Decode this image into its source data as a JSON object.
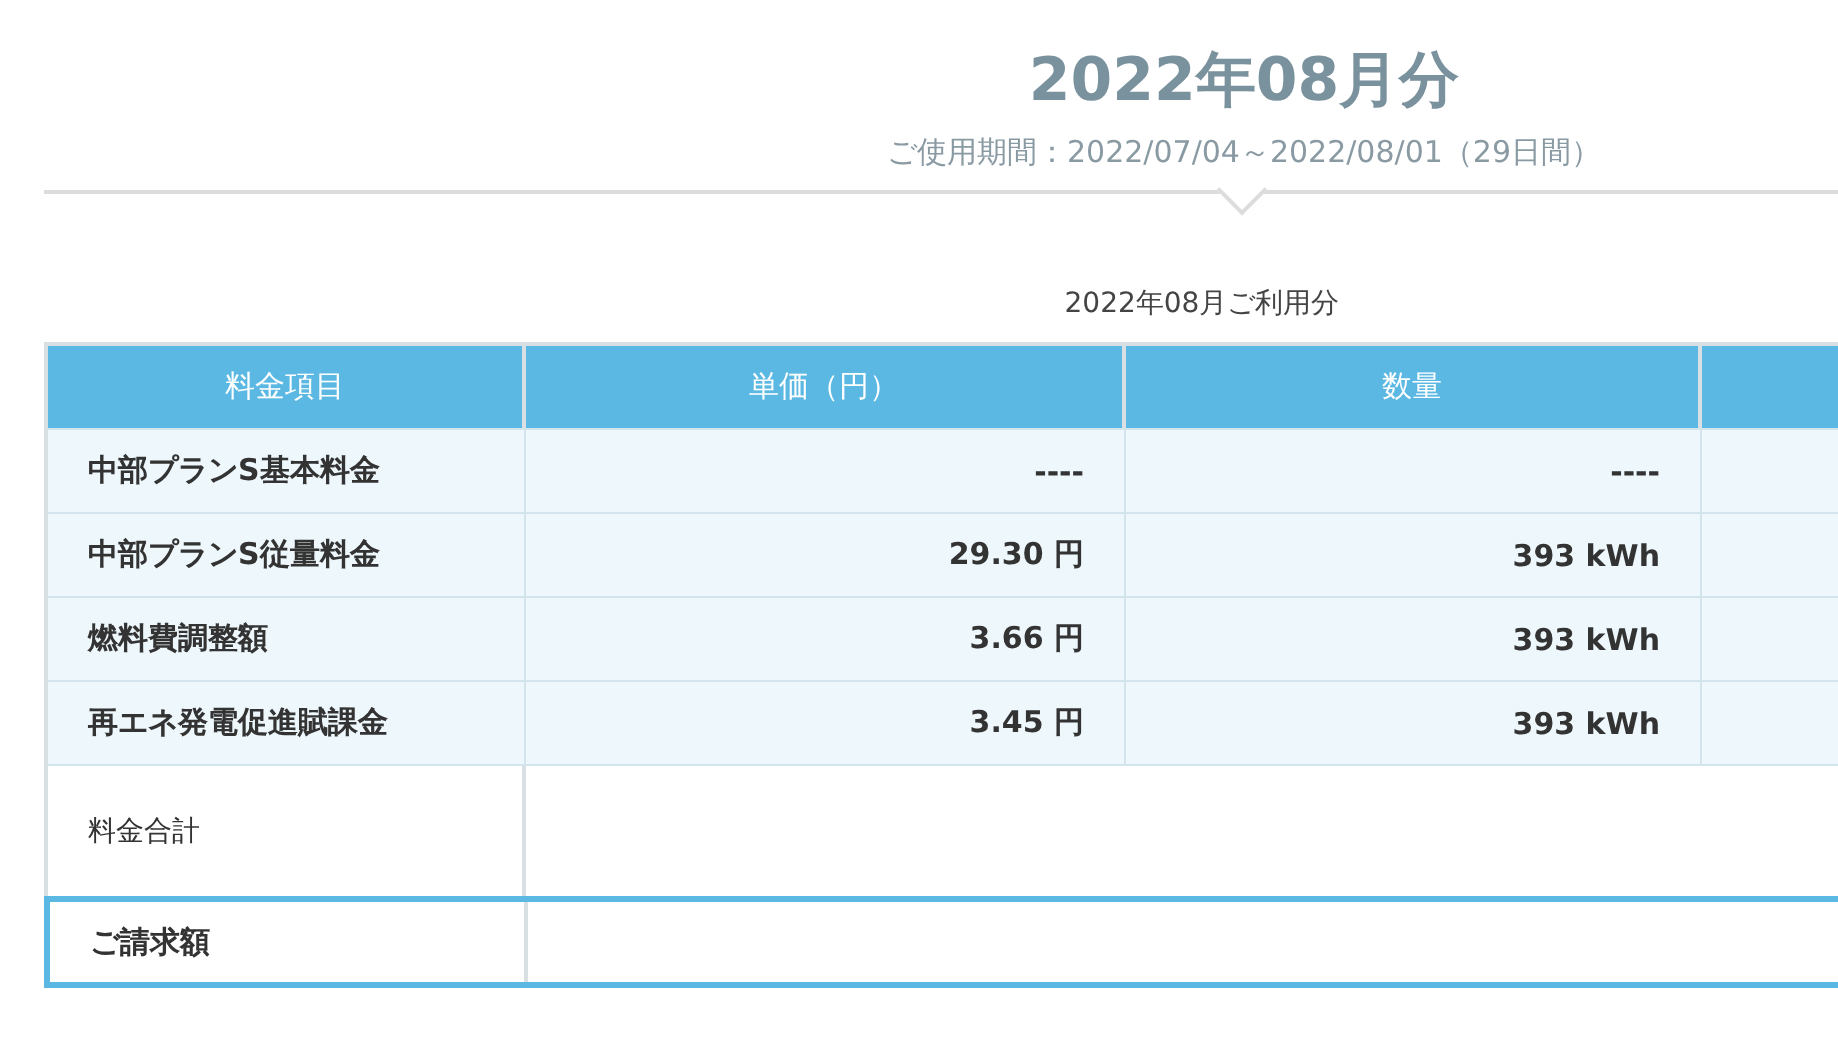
{
  "heading": {
    "title": "2022年08月分",
    "period": "ご使用期間：2022/07/04～2022/08/01（29日間）"
  },
  "table": {
    "caption": "2022年08月ご利用分",
    "columns": [
      "料金項目",
      "単価（円）",
      "数量"
    ],
    "rows": [
      {
        "item": "中部プランS基本料金",
        "unit_price": "----",
        "quantity": "----"
      },
      {
        "item": "中部プランS従量料金",
        "unit_price": "29.30 円",
        "quantity": "393 kWh"
      },
      {
        "item": "燃料費調整額",
        "unit_price": "3.66 円",
        "quantity": "393 kWh"
      },
      {
        "item": "再エネ発電促進賦課金",
        "unit_price": "3.45 円",
        "quantity": "393 kWh"
      }
    ],
    "total_label": "料金合計",
    "billing_label": "ご請求額"
  }
}
